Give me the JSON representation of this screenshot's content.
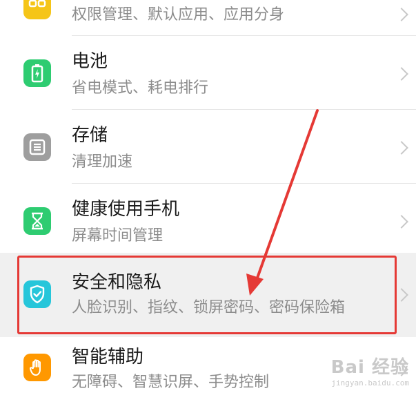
{
  "items": [
    {
      "title": "",
      "subtitle": "权限管理、默认应用、应用分身",
      "icon": "apps-icon",
      "color": "#F5C518"
    },
    {
      "title": "电池",
      "subtitle": "省电模式、耗电排行",
      "icon": "battery-icon",
      "color": "#2ECC71"
    },
    {
      "title": "存储",
      "subtitle": "清理加速",
      "icon": "storage-icon",
      "color": "#9E9E9E"
    },
    {
      "title": "健康使用手机",
      "subtitle": "屏幕时间管理",
      "icon": "hourglass-icon",
      "color": "#2ECC71"
    },
    {
      "title": "安全和隐私",
      "subtitle": "人脸识别、指纹、锁屏密码、密码保险箱",
      "icon": "shield-icon",
      "color": "#26C6DA"
    },
    {
      "title": "智能辅助",
      "subtitle": "无障碍、智慧识屏、手势控制",
      "icon": "hand-icon",
      "color": "#FF9800"
    }
  ],
  "annotation": {
    "highlight_color": "#E53935",
    "arrow_color": "#E53935"
  },
  "watermark": {
    "logo": "Bai 经验",
    "url": "jingyan.baidu.com"
  }
}
